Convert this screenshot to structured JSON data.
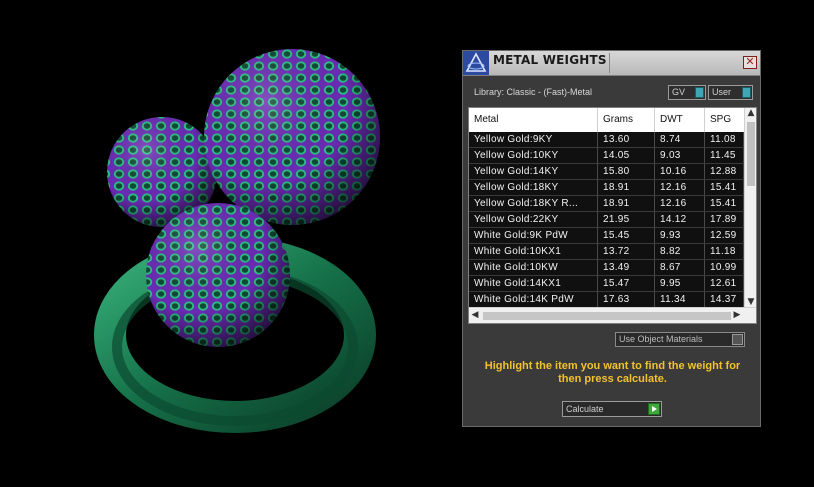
{
  "colors": {
    "background": "#000000",
    "metal_green": "#1f8a5c",
    "sphere_purple": "#7a35c6",
    "hint_yellow": "#f2c22d",
    "toggle_accent": "#3fa6b4",
    "calculate_green": "#3fa83a"
  },
  "panel": {
    "title": "METAL WEIGHTS",
    "close_icon": "✕",
    "library_label": "Library: Classic - (Fast)-Metal",
    "toggles": {
      "gv": "GV",
      "user": "User"
    },
    "table": {
      "columns": [
        "Metal",
        "Grams",
        "DWT",
        "SPG"
      ],
      "rows": [
        [
          "Yellow Gold:9KY",
          "13.60",
          "8.74",
          "11.08"
        ],
        [
          "Yellow Gold:10KY",
          "14.05",
          "9.03",
          "11.45"
        ],
        [
          "Yellow Gold:14KY",
          "15.80",
          "10.16",
          "12.88"
        ],
        [
          "Yellow Gold:18KY",
          "18.91",
          "12.16",
          "15.41"
        ],
        [
          "Yellow Gold:18KY R...",
          "18.91",
          "12.16",
          "15.41"
        ],
        [
          "Yellow Gold:22KY",
          "21.95",
          "14.12",
          "17.89"
        ],
        [
          "White Gold:9K PdW",
          "15.45",
          "9.93",
          "12.59"
        ],
        [
          "White Gold:10KX1",
          "13.72",
          "8.82",
          "11.18"
        ],
        [
          "White Gold:10KW",
          "13.49",
          "8.67",
          "10.99"
        ],
        [
          "White Gold:14KX1",
          "15.47",
          "9.95",
          "12.61"
        ],
        [
          "White Gold:14K PdW",
          "17.63",
          "11.34",
          "14.37"
        ]
      ]
    },
    "use_object_materials": "Use Object Materials",
    "hint": "Highlight the item you want to find the weight for then press calculate.",
    "calculate_button": "Calculate"
  }
}
